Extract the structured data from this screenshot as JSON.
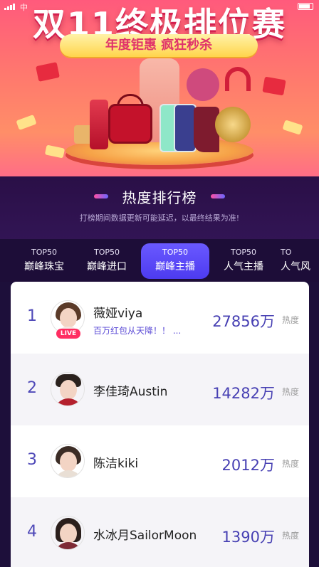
{
  "status_bar": {
    "carrier": "中"
  },
  "banner": {
    "title": "双11终极排位赛",
    "subtitle": "年度钜惠 疯狂秒杀"
  },
  "section": {
    "title": "热度排行榜",
    "notice": "打榜期间数据更新可能延迟，以最终结果为准!"
  },
  "tabs": [
    {
      "top": "TOP50",
      "label": "巅峰珠宝"
    },
    {
      "top": "TOP50",
      "label": "巅峰进口"
    },
    {
      "top": "TOP50",
      "label": "巅峰主播",
      "active": true
    },
    {
      "top": "TOP50",
      "label": "人气主播"
    },
    {
      "top": "TO",
      "label": "人气风"
    }
  ],
  "ranking": [
    {
      "rank": "1",
      "name": "薇娅viya",
      "promo": "百万红包从天降！！ ...",
      "live": "LIVE",
      "score": "27856万",
      "score_label": "热度"
    },
    {
      "rank": "2",
      "name": "李佳琦Austin",
      "score": "14282万",
      "score_label": "热度"
    },
    {
      "rank": "3",
      "name": "陈洁kiki",
      "score": "2012万",
      "score_label": "热度"
    },
    {
      "rank": "4",
      "name": "水冰月SailorMoon",
      "score": "1390万",
      "score_label": "热度"
    }
  ],
  "colors": {
    "accent": "#4d3bf0",
    "rank_text": "#4f49b8",
    "live": "#ff2e62"
  }
}
